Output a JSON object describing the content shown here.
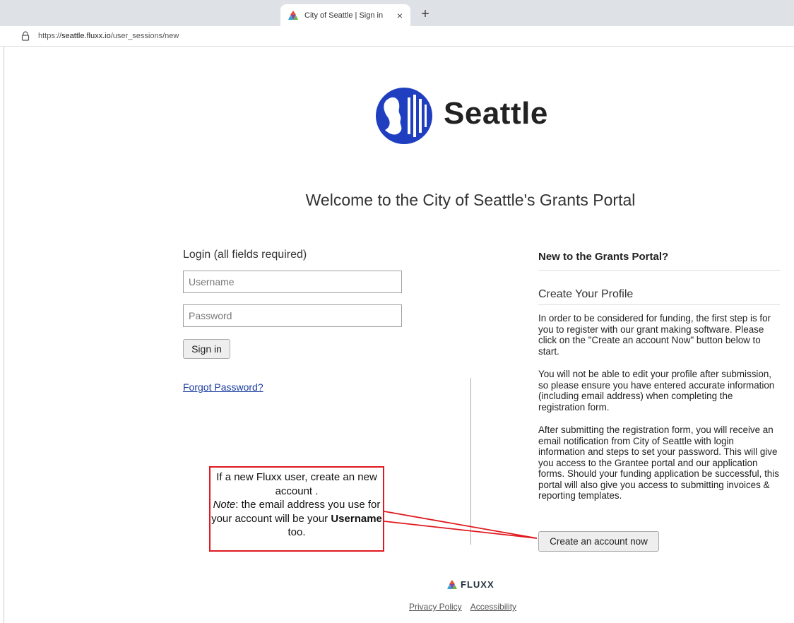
{
  "browser": {
    "tab_title": "City of Seattle | Sign in",
    "tab_close": "×",
    "new_tab": "+",
    "url_prefix": "https://",
    "url_host": "seattle.fluxx.io",
    "url_path": "/user_sessions/new"
  },
  "logo": {
    "text": "Seattle",
    "brand_color": "#1f3fc0"
  },
  "welcome": "Welcome to the City of Seattle's Grants Portal",
  "login": {
    "heading": "Login (all fields required)",
    "username_placeholder": "Username",
    "password_placeholder": "Password",
    "sign_in_label": "Sign in",
    "forgot_label": "Forgot Password?"
  },
  "new_user": {
    "heading": "New to the Grants Portal?",
    "profile_heading": "Create Your Profile",
    "para1": "In order to be considered for funding, the first step is for you to register with our grant making software. Please click on the \"Create an account Now\" button below to start.",
    "para2": "You will not be able to edit your profile after submission, so please ensure you have entered accurate information (including email address) when completing the registration form.",
    "para3": "After submitting the registration form, you will receive an email notification from City of Seattle with login information and steps to set your password.  This will give you access to the Grantee portal and our application forms. Should your funding application be successful, this portal will also give you access to submitting invoices & reporting templates.",
    "create_label": "Create an account now"
  },
  "callout": {
    "line1": "If a new Fluxx user, create an new account .",
    "note_label": "Note",
    "line2": ": the email address you use for your account will be your ",
    "username_word": "Username",
    "line3": " too.",
    "border_color": "#e0191e"
  },
  "footer": {
    "brand": "FLUXX",
    "privacy": "Privacy Policy",
    "accessibility": "Accessibility"
  }
}
